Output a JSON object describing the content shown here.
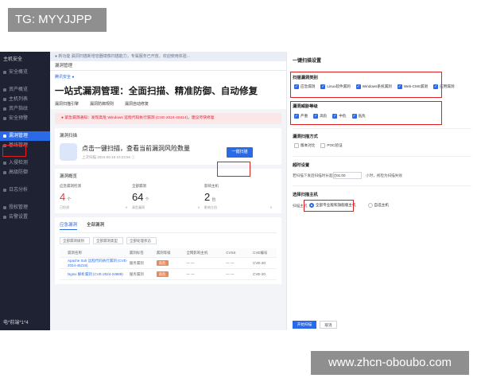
{
  "overlay": {
    "tag": "TG: MYYJJPP",
    "watermark": "www.zhcn-oboubo.com"
  },
  "sidebar": {
    "brand": "主机安全",
    "items": [
      "安全概览",
      "资产概览",
      "主机列表",
      "资产指纹",
      "安全预警",
      "漏洞管理",
      "基线管理",
      "入侵检测",
      "高级防御",
      "日志分析",
      "授权管理",
      "告警设置"
    ],
    "footer": "电*前端*1*4"
  },
  "console": {
    "notice": "● 新功能    漏洞扫描新增容器镜像扫描能力，专属服务已开放，欢迎使用体验...",
    "crumb": "漏洞管理",
    "brandline": "腾讯安全 ●",
    "title": "一站式漏洞管理：全面扫描、精准防御、自动修复",
    "tabs": [
      "漏洞扫描引擎",
      "漏洞防御规则",
      "漏洞自动修复"
    ],
    "alert": "● 紧急漏洞通知：发现高危 Windows 远程代码执行漏洞 (CVE-2024-40414)，建议尽快修复",
    "scan_card": {
      "title": "漏洞扫描",
      "main": "点击一键扫描，查看当前漏洞风险数量",
      "sub": "上次扫描 2024-06-18 10:23:56 ⓘ",
      "button": "一键扫描"
    },
    "overview": {
      "title": "漏洞概览",
      "stats": [
        {
          "label": "应急漏洞检测",
          "value": "4",
          "unit": "个",
          "left": "已检测",
          "right": "0"
        },
        {
          "label": "全部漏洞",
          "value": "64",
          "unit": "个",
          "left": "高危漏洞",
          "right": "0"
        },
        {
          "label": "影响主机",
          "value": "2",
          "unit": "台",
          "left": "影响主机",
          "right": "0"
        }
      ]
    },
    "table": {
      "tabs": [
        "应急漏洞",
        "全部漏洞"
      ],
      "filters": [
        "全部漏洞级别",
        "全部漏洞类型",
        "全部处理状态"
      ],
      "headers": [
        "漏洞名称",
        "漏洞标签",
        "漏洞等级",
        "全网影响主机",
        "CVSS",
        "CVE编号"
      ],
      "rows": [
        {
          "name": "Apache Solr 远程代码执行漏洞 (CVE-2024-45216)",
          "tag": "服务漏洞",
          "level": "高危",
          "hosts": "— —",
          "cvss": "— —",
          "cve": "CVE-20"
        },
        {
          "name": "Nginx 解析漏洞 (CVE-2024-24989)",
          "tag": "服务漏洞",
          "level": "高危",
          "hosts": "— —",
          "cvss": "— —",
          "cve": "CVE-20"
        }
      ]
    }
  },
  "drawer": {
    "title": "一键扫描设置",
    "type_section": "扫描漏洞类别",
    "types": [
      "应急漏洞",
      "Linux软件漏洞",
      "Windows系统漏洞",
      "Web-CMS漏洞",
      "应用漏洞"
    ],
    "level_section": "漏洞威胁等级",
    "levels": [
      "严重",
      "高危",
      "中危",
      "低危"
    ],
    "method_section": "漏洞扫描方式",
    "methods": [
      "版本对比",
      "POC验证"
    ],
    "timeout_section": "超时设置",
    "timeout_prefix": "若扫描下发后扫描时长超过",
    "timeout_value": "01:00",
    "timeout_suffix": "小时，视检为扫描失败",
    "host_section": "选择扫描主机",
    "host_label": "扫描主机",
    "host_options": [
      "全部专业版和旗舰版主机",
      "自选主机"
    ],
    "confirm": "开始扫描",
    "cancel": "取消"
  }
}
